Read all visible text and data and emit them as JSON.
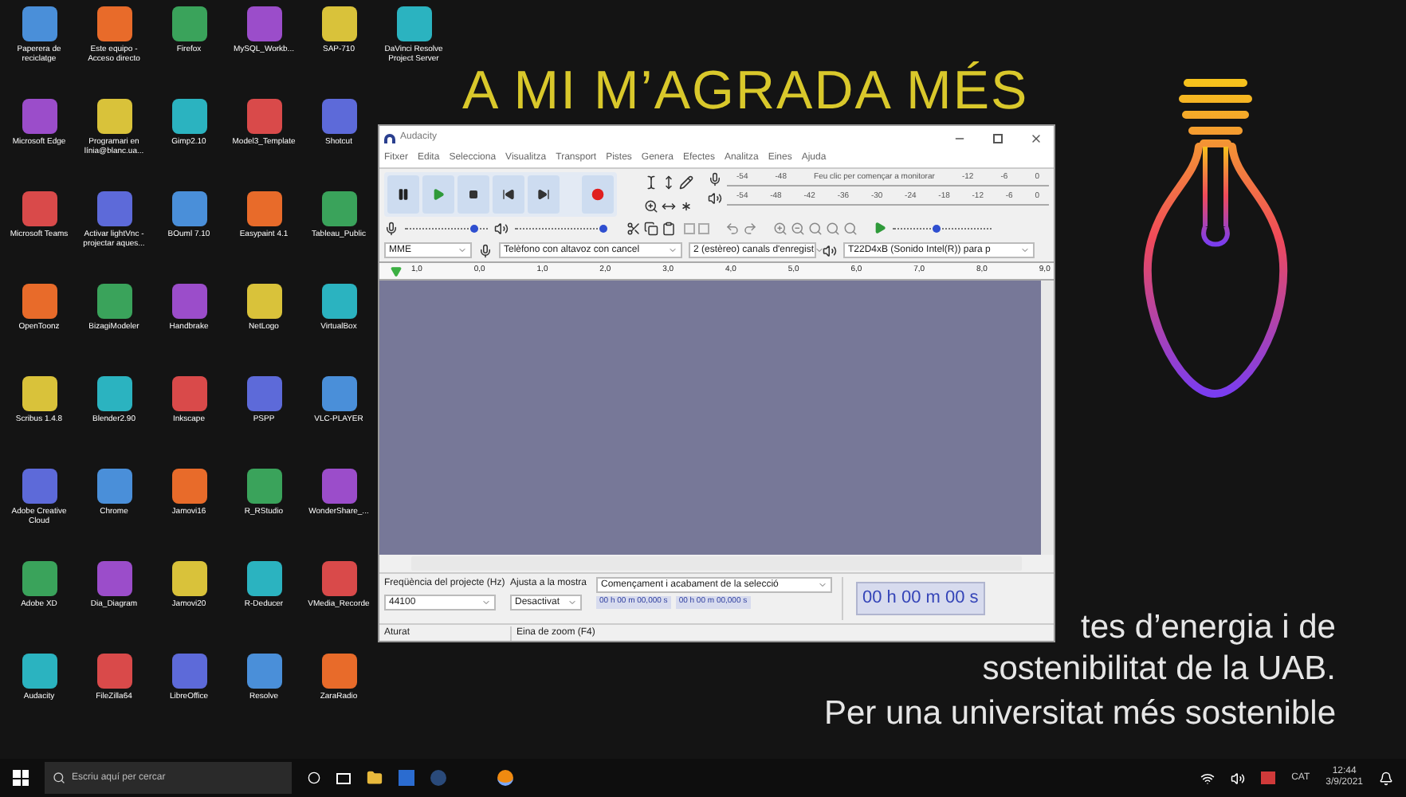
{
  "wallpaper": {
    "slogan": "A MI M’AGRADA MÉS",
    "caption_lines": [
      "tes d’energia i de",
      "sostenibilitat de la UAB.",
      "Per una universitat més sostenible"
    ]
  },
  "desktop_icons": [
    [
      "Paperera de reciclatge",
      "Este equipo - Acceso directo",
      "Firefox",
      "MySQL_Workb...",
      "SAP-710",
      "DaVinci Resolve Project Server"
    ],
    [
      "Microsoft Edge",
      "Programari en línia@blanc.ua...",
      "Gimp2.10",
      "Model3_Template",
      "Shotcut"
    ],
    [
      "Microsoft Teams",
      "Activar lightVnc -projectar aques...",
      "BOuml 7.10",
      "Easypaint 4.1",
      "Tableau_Public"
    ],
    [
      "OpenToonz",
      "BizagiModeler",
      "Handbrake",
      "NetLogo",
      "VirtualBox"
    ],
    [
      "Scribus 1.4.8",
      "Blender2.90",
      "Inkscape",
      "PSPP",
      "VLC-PLAYER"
    ],
    [
      "Adobe Creative Cloud",
      "Chrome",
      "Jamovi16",
      "R_RStudio",
      "WonderShare_..."
    ],
    [
      "Adobe XD",
      "Dia_Diagram",
      "Jamovi20",
      "R-Deducer",
      "VMedia_Recorde"
    ],
    [
      "Audacity",
      "FileZilla64",
      "LibreOffice",
      "Resolve",
      "ZaraRadio"
    ]
  ],
  "audacity": {
    "title": "Audacity",
    "menu": [
      "Fitxer",
      "Edita",
      "Selecciona",
      "Visualitza",
      "Transport",
      "Pistes",
      "Genera",
      "Efectes",
      "Analitza",
      "Eines",
      "Ajuda"
    ],
    "record_meter": [
      "-54",
      "-48",
      "Feu clic per començar a monitorar",
      "-12",
      "-6",
      "0"
    ],
    "play_meter": [
      "-54",
      "-48",
      "-42",
      "-36",
      "-30",
      "-24",
      "-18",
      "-12",
      "-6",
      "0"
    ],
    "recording_volume": {
      "level": 0.85
    },
    "playback_volume": {
      "level": 1
    },
    "play_speed": {
      "level": 0.45
    },
    "devices": {
      "host": "MME",
      "input": "Telèfono con altavoz con cancel",
      "channels": "2 (estèreo) canals d'enregist",
      "output": "T22D4xB (Sonido Intel(R)) para p"
    },
    "ruler": [
      "1,0",
      "0,0",
      "1,0",
      "2,0",
      "3,0",
      "4,0",
      "5,0",
      "6,0",
      "7,0",
      "8,0",
      "9,0"
    ],
    "selection_bar": {
      "rate_label": "Freqüència del projecte (Hz)",
      "rate": "44100",
      "snap_label": "Ajusta a la mostra",
      "snap": "Desactivat",
      "selection_label": "Començament i acabament de la selecció",
      "start": "00 h 00 m 00,000 s",
      "end": "00 h 00 m 00,000 s",
      "time": "00 h 00 m 00 s"
    },
    "status": "Aturat",
    "status_hint": "Eina de zoom (F4)"
  },
  "taskbar": {
    "search_placeholder": "Escriu aquí per cercar",
    "language": "CAT",
    "time": "12:44",
    "date": "3/9/2021"
  }
}
